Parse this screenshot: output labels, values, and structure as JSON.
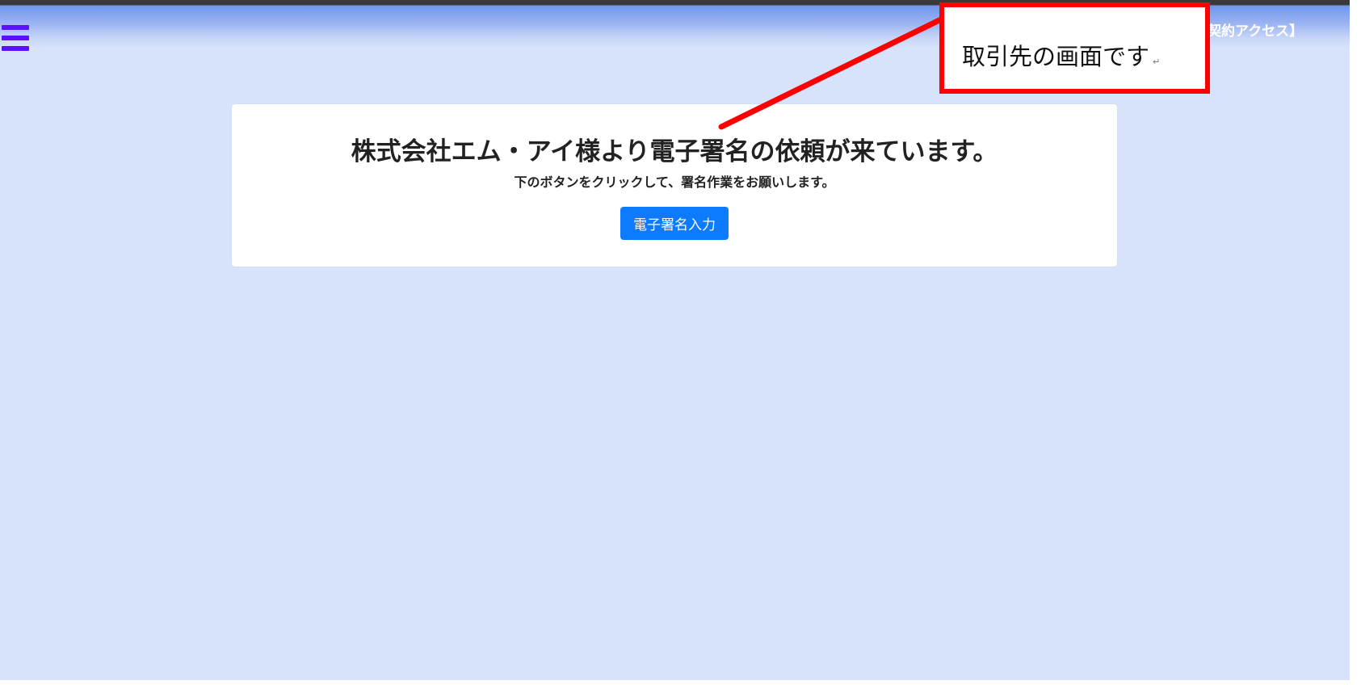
{
  "header": {
    "label": "契約アクセス】"
  },
  "card": {
    "title": "株式会社エム・アイ様より電子署名の依頼が来ています。",
    "subtitle": "下のボタンをクリックして、署名作業をお願いします。",
    "button_label": "電子署名入力"
  },
  "callout": {
    "text": "取引先の画面です",
    "mark": "↵"
  },
  "colors": {
    "background": "#d7e3fb",
    "menu_icon": "#5b10ff",
    "button": "#0d7bff",
    "callout_border": "#ff0000"
  }
}
